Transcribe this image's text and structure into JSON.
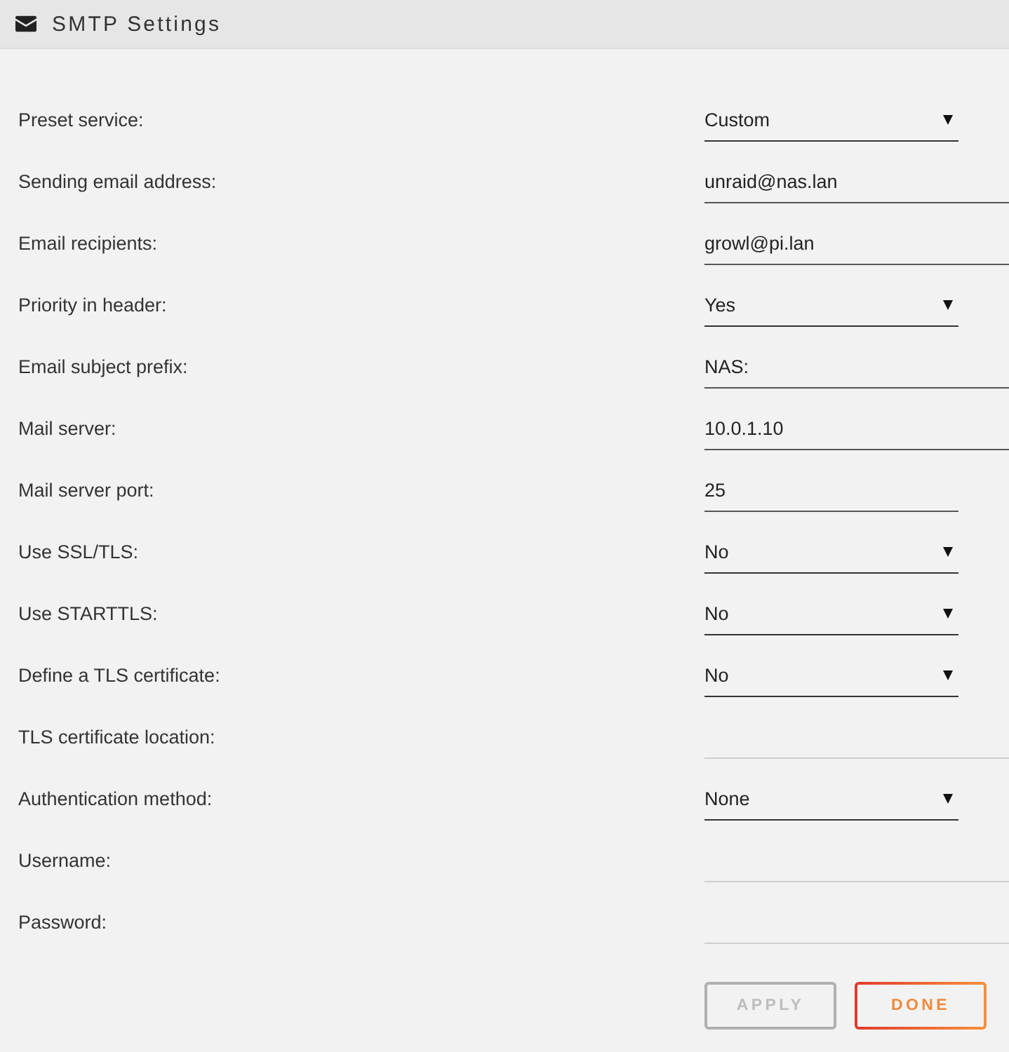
{
  "header": {
    "title": "SMTP Settings"
  },
  "fields": [
    {
      "label": "Preset service:",
      "kind": "select",
      "value": "Custom",
      "disabled": false
    },
    {
      "label": "Sending email address:",
      "kind": "text",
      "value": "unraid@nas.lan",
      "disabled": false
    },
    {
      "label": "Email recipients:",
      "kind": "text",
      "value": "growl@pi.lan",
      "disabled": false
    },
    {
      "label": "Priority in header:",
      "kind": "select",
      "value": "Yes",
      "disabled": false
    },
    {
      "label": "Email subject prefix:",
      "kind": "text",
      "value": "NAS:",
      "disabled": false
    },
    {
      "label": "Mail server:",
      "kind": "text",
      "value": "10.0.1.10",
      "disabled": false
    },
    {
      "label": "Mail server port:",
      "kind": "number",
      "value": "25",
      "disabled": false
    },
    {
      "label": "Use SSL/TLS:",
      "kind": "select",
      "value": "No",
      "disabled": false
    },
    {
      "label": "Use STARTTLS:",
      "kind": "select",
      "value": "No",
      "disabled": false
    },
    {
      "label": "Define a TLS certificate:",
      "kind": "select",
      "value": "No",
      "disabled": false
    },
    {
      "label": "TLS certificate location:",
      "kind": "text",
      "disabled": true
    },
    {
      "label": "Authentication method:",
      "kind": "select",
      "value": "None",
      "disabled": false
    },
    {
      "label": "Username:",
      "kind": "text",
      "disabled": true
    },
    {
      "label": "Password:",
      "kind": "text",
      "disabled": true
    }
  ],
  "buttons": [
    {
      "label": "APPLY",
      "disabled": true
    },
    {
      "label": "DONE",
      "disabled": false
    }
  ]
}
